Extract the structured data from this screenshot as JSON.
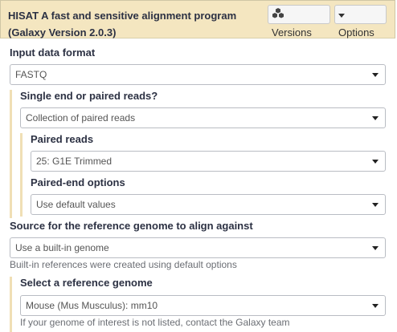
{
  "header": {
    "title": "HISAT A fast and sensitive alignment program (Galaxy Version 2.0.3)",
    "versions_label": "Versions",
    "options_label": "Options"
  },
  "form": {
    "input_format": {
      "label": "Input data format",
      "value": "FASTQ"
    },
    "reads_type": {
      "label": "Single end or paired reads?",
      "value": "Collection of paired reads"
    },
    "paired_reads": {
      "label": "Paired reads",
      "value": "25: G1E Trimmed"
    },
    "paired_options": {
      "label": "Paired-end options",
      "value": "Use default values"
    },
    "reference_source": {
      "label": "Source for the reference genome to align against",
      "value": "Use a built-in genome",
      "help": "Built-in references were created using default options"
    },
    "reference_genome": {
      "label": "Select a reference genome",
      "value": "Mouse (Mus Musculus): mm10",
      "help": "If your genome of interest is not listed, contact the Galaxy team"
    }
  },
  "colors": {
    "header_bg": "#f4e6c0",
    "section_bar": "#f0dfb5"
  }
}
